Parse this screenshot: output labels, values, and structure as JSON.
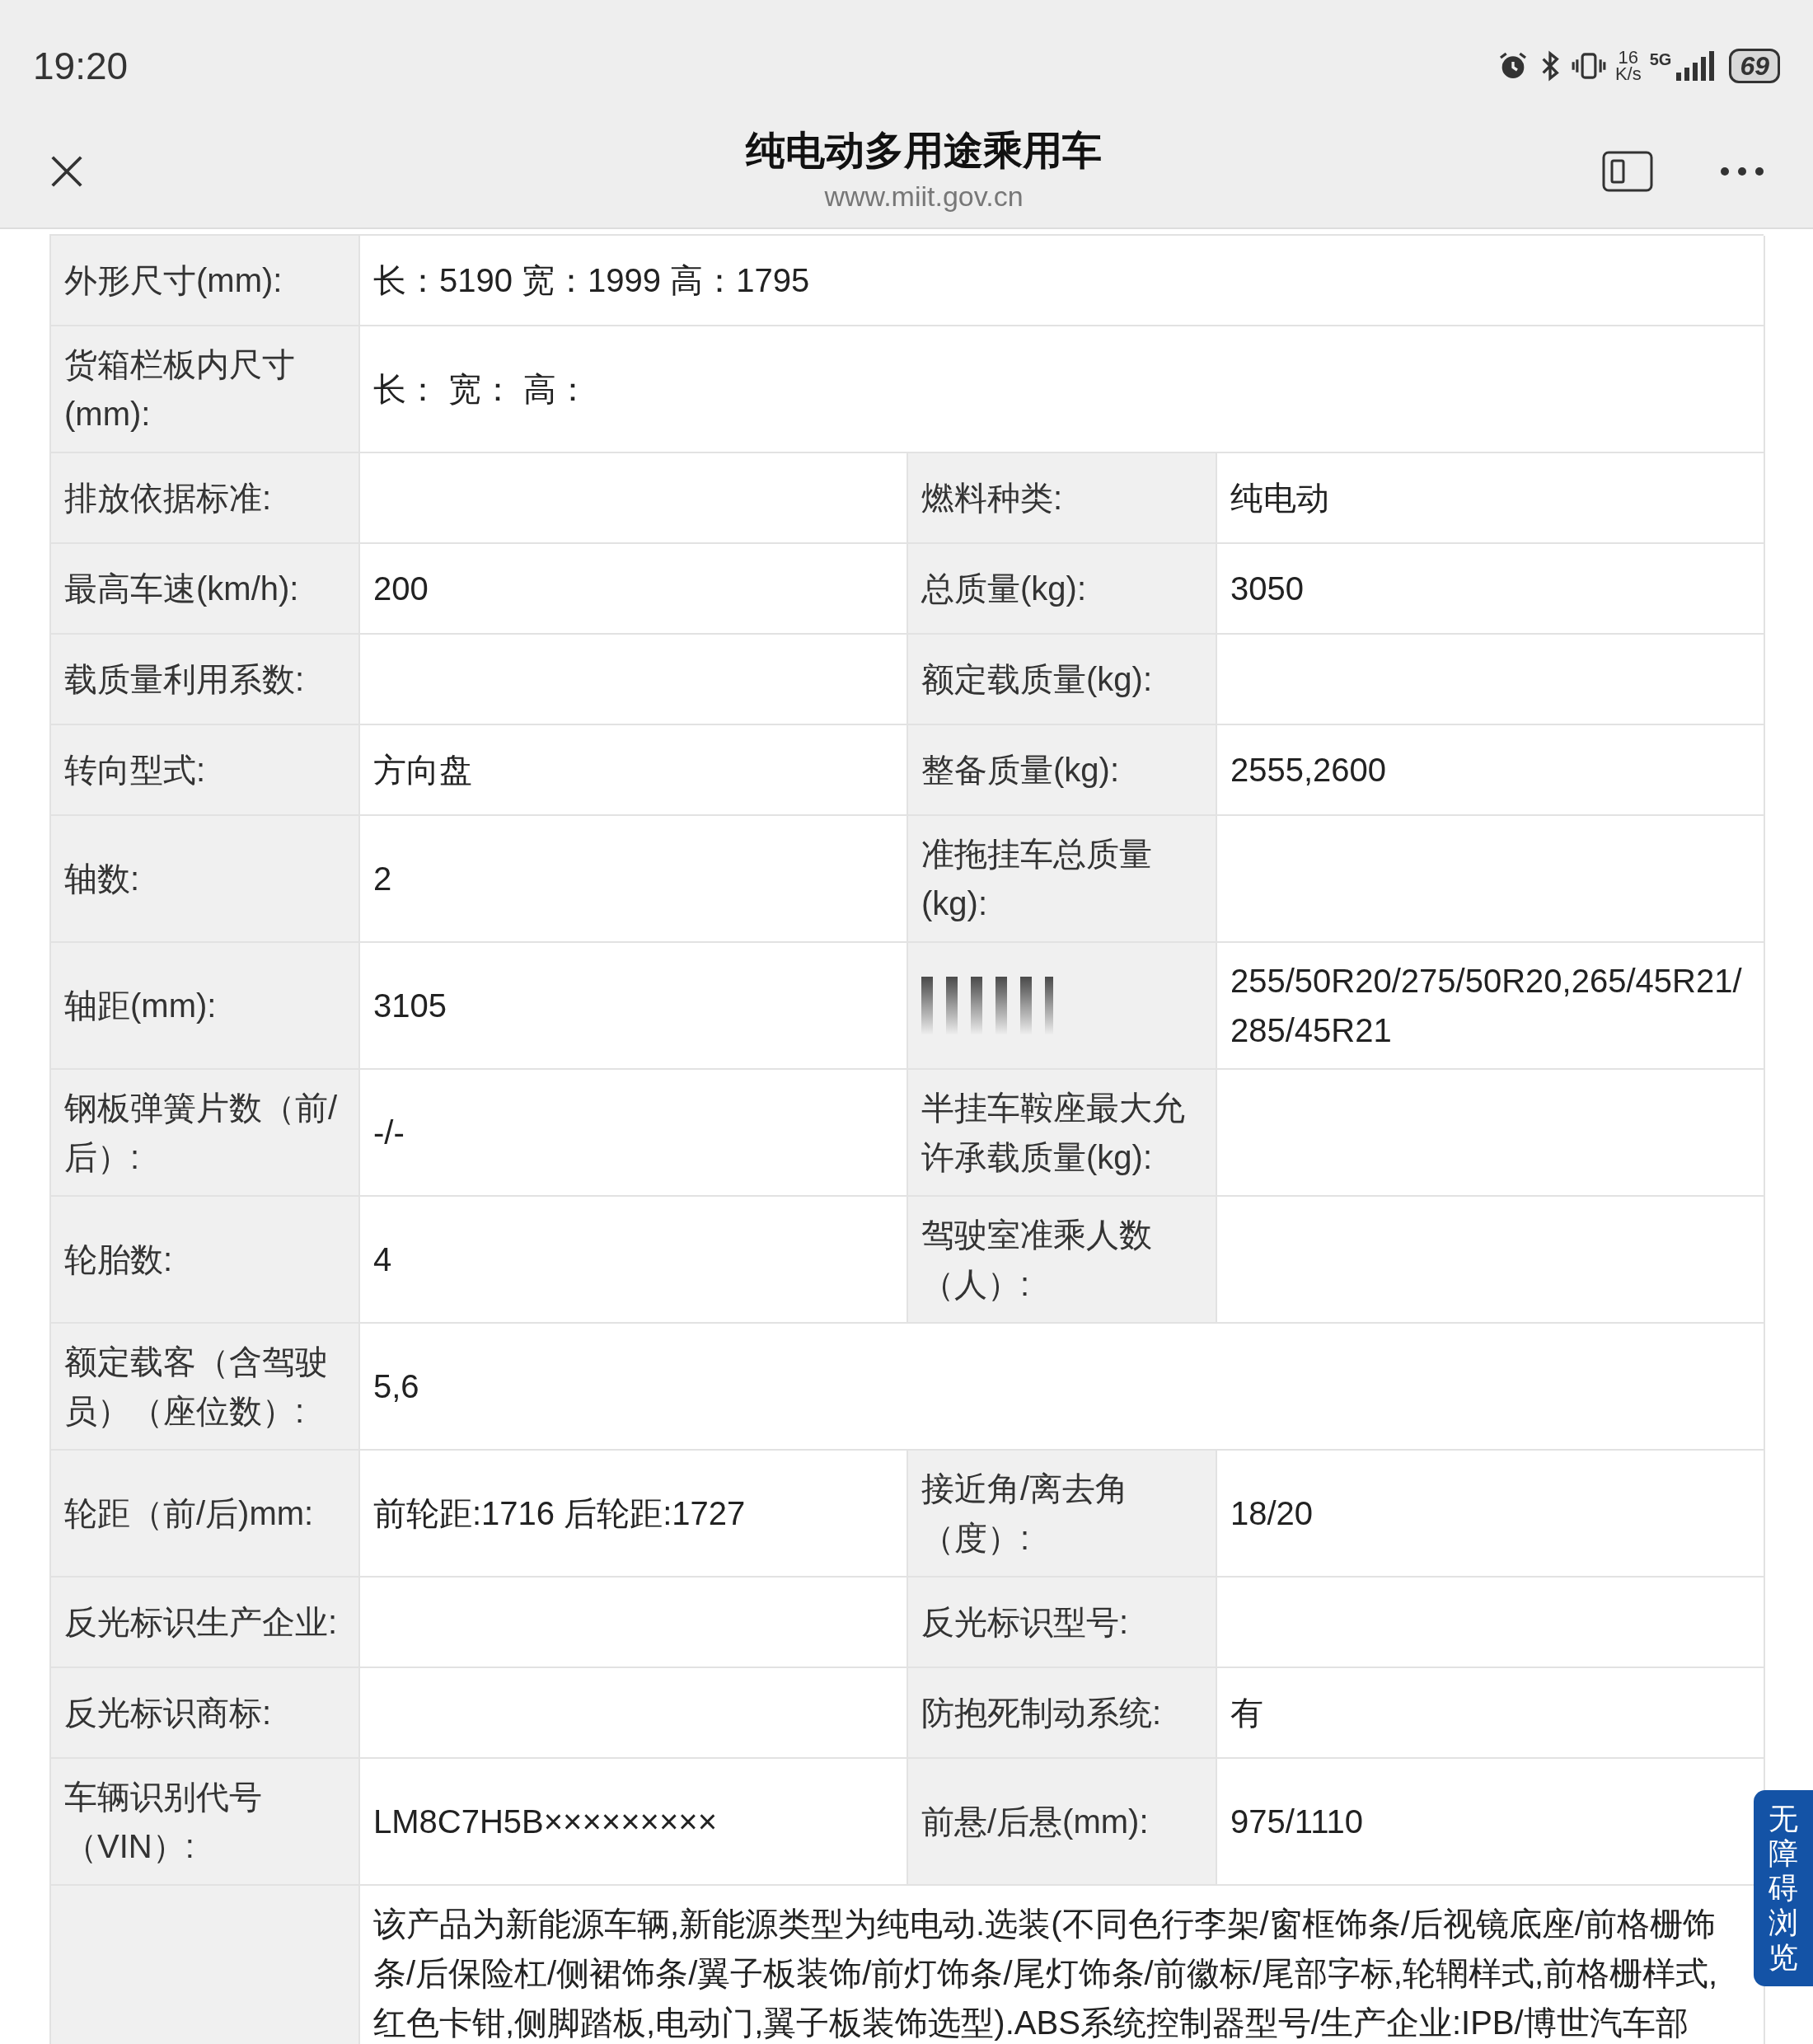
{
  "status_bar": {
    "time": "19:20",
    "net_speed_value": "16",
    "net_speed_unit": "K/s",
    "network": "5G",
    "battery": "69"
  },
  "header": {
    "title": "纯电动多用途乘用车",
    "url": "www.miit.gov.cn"
  },
  "table": {
    "rows": [
      {
        "cells": [
          {
            "kind": "text",
            "label": "外形尺寸(mm):",
            "value": "长：5190 宽：1999 高：1795"
          }
        ]
      },
      {
        "cells": [
          {
            "kind": "text",
            "label": "货箱栏板内尺寸(mm):",
            "value": "长：  宽：  高："
          }
        ]
      },
      {
        "cells": [
          {
            "kind": "text",
            "label": "排放依据标准:"
          },
          {
            "kind": "text",
            "label": "燃料种类:",
            "value": "纯电动"
          }
        ]
      },
      {
        "cells": [
          {
            "kind": "text",
            "label": "最高车速(km/h):",
            "value": "200"
          },
          {
            "kind": "text",
            "label": "总质量(kg):",
            "value": "3050"
          }
        ]
      },
      {
        "cells": [
          {
            "kind": "text",
            "label": "载质量利用系数:"
          },
          {
            "kind": "text",
            "label": "额定载质量(kg):"
          }
        ]
      },
      {
        "cells": [
          {
            "kind": "text",
            "label": "转向型式:",
            "value": "方向盘"
          },
          {
            "kind": "text",
            "label": "整备质量(kg):",
            "value": "2555,2600"
          }
        ]
      },
      {
        "cells": [
          {
            "kind": "text",
            "label": "轴数:",
            "value": "2"
          },
          {
            "kind": "text",
            "label": "准拖挂车总质量(kg):"
          }
        ]
      },
      {
        "cells": [
          {
            "kind": "text",
            "label": "轴距(mm):",
            "value": "3105"
          },
          {
            "kind": "smeared",
            "value": "255/50R20/275/50R20,265/45R21/285/45R21"
          }
        ]
      },
      {
        "cells": [
          {
            "kind": "text",
            "label": "钢板弹簧片数（前/后）:",
            "value": "-/-"
          },
          {
            "kind": "text",
            "label": "半挂车鞍座最大允许承载质量(kg):"
          }
        ]
      },
      {
        "cells": [
          {
            "kind": "text",
            "label": "轮胎数:",
            "value": "4"
          },
          {
            "kind": "text",
            "label": "驾驶室准乘人数（人）:"
          }
        ]
      },
      {
        "cells": [
          {
            "kind": "text",
            "label": "额定载客（含驾驶员）（座位数）:",
            "value": "5,6"
          }
        ]
      },
      {
        "cells": [
          {
            "kind": "text",
            "label": "轮距（前/后)mm:",
            "value": "前轮距:1716 后轮距:1727"
          },
          {
            "kind": "text",
            "label": "接近角/离去角（度）:",
            "value": "18/20"
          }
        ]
      },
      {
        "cells": [
          {
            "kind": "text",
            "label": "反光标识生产企业:"
          },
          {
            "kind": "text",
            "label": "反光标识型号:"
          }
        ]
      },
      {
        "cells": [
          {
            "kind": "text",
            "label": "反光标识商标:"
          },
          {
            "kind": "text",
            "label": "防抱死制动系统:",
            "value": "有"
          }
        ]
      },
      {
        "cells": [
          {
            "kind": "text",
            "label": "车辆识别代号（VIN）:",
            "value": "LM8C7H5B×××××××××"
          },
          {
            "kind": "text",
            "label": "前悬/后悬(mm):",
            "value": "975/1110"
          }
        ]
      },
      {
        "cells": [
          {
            "kind": "text",
            "value": "该产品为新能源车辆,新能源类型为纯电动.选装(不同色行李架/窗框饰条/后视镜底座/前格栅饰条/后保险杠/侧裙饰条/翼子板装饰/前灯饰条/尾灯饰条/前徽标/尾部字标,轮辋样式,前格栅样式,红色卡钳,侧脚踏板,电动门,翼子板装饰选型).ABS系统控制器型号/生产企业:IPB/博世汽车部"
          }
        ]
      }
    ]
  },
  "accessibility_button": {
    "label": "无障碍浏览"
  }
}
